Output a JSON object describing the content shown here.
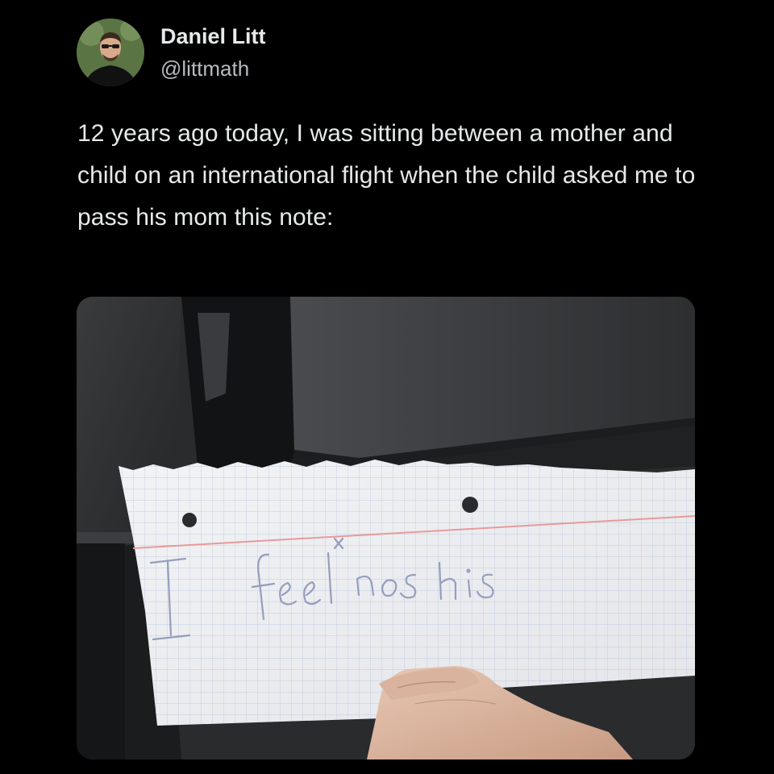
{
  "author": {
    "display_name": "Daniel Litt",
    "handle": "@littmath",
    "avatar_icon": "avatar-photo"
  },
  "tweet": {
    "text": "12 years ago today, I was sitting between a mother and child on an international flight when the child asked me to pass his mom this note:"
  },
  "media": {
    "note_text": "I feel nos his",
    "description_icon": "photo-of-handwritten-note"
  },
  "colors": {
    "background": "#000000",
    "text": "#e7e9ea",
    "handle": "#b7bbbf"
  }
}
